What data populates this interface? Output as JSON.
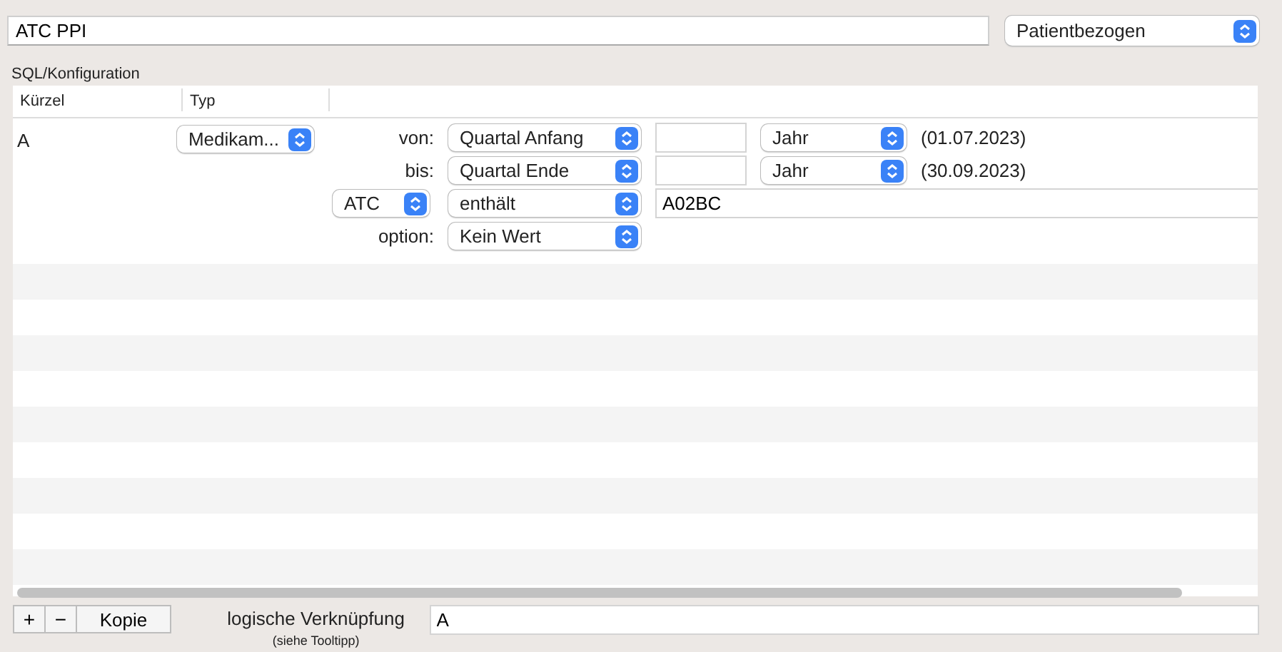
{
  "name_field": {
    "value": "ATC PPI"
  },
  "scope_select": {
    "value": "Patientbezogen"
  },
  "section_label": "SQL/Konfiguration",
  "table": {
    "columns": [
      "Kürzel",
      "Typ"
    ],
    "rows": [
      {
        "kuerzel": "A",
        "typ": "Medikam...",
        "conditions": [
          {
            "kind": "date",
            "label": "von:",
            "select": "Quartal Anfang",
            "unit": "Jahr",
            "date": "(01.07.2023)"
          },
          {
            "kind": "date",
            "label": "bis:",
            "select": "Quartal Ende",
            "unit": "Jahr",
            "date": "(30.09.2023)"
          },
          {
            "kind": "filter",
            "field_select": "ATC",
            "select": "enthält",
            "value": "A02BC"
          },
          {
            "kind": "option",
            "label": "option:",
            "select": "Kein Wert"
          }
        ]
      }
    ]
  },
  "bottom": {
    "buttons": [
      "+",
      "−",
      "Kopie"
    ],
    "logic_label": "logische Verknüpfung",
    "logic_hint": "(siehe Tooltipp)",
    "logic_value": "A"
  }
}
